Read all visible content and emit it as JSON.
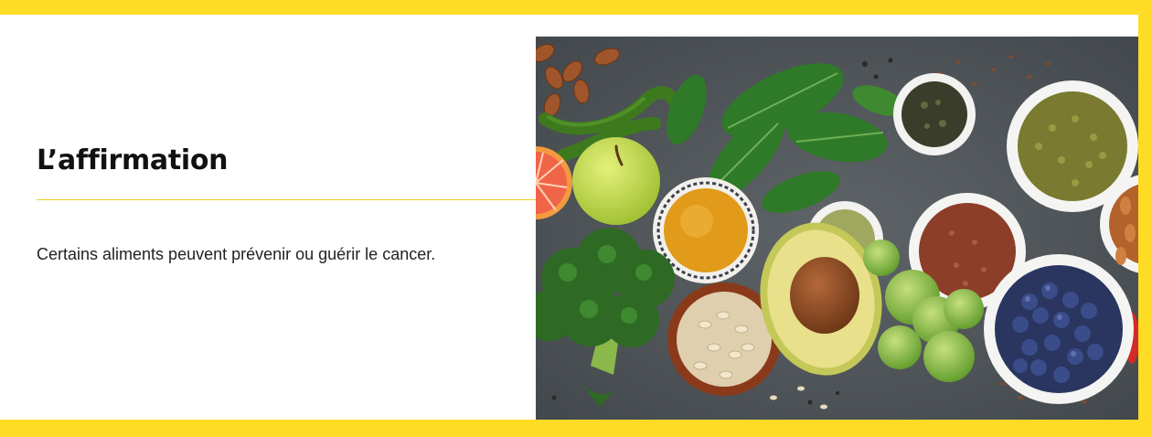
{
  "claim": {
    "heading": "L’affirmation",
    "text": "Certains aliments peuvent prévenir ou guérir le cancer."
  },
  "colors": {
    "frame": "#fedb24",
    "divider": "#f2cf24",
    "heading": "#111111",
    "text": "#222222",
    "photo_background": "#53585c"
  },
  "photo": {
    "subject": "healthy foods flat lay: almonds, chili peppers, grapefruit, apple, spinach, turmeric, broccoli, oats, avocado, matcha, flax seeds, lentils, green tea, brussels sprouts, blueberries"
  }
}
